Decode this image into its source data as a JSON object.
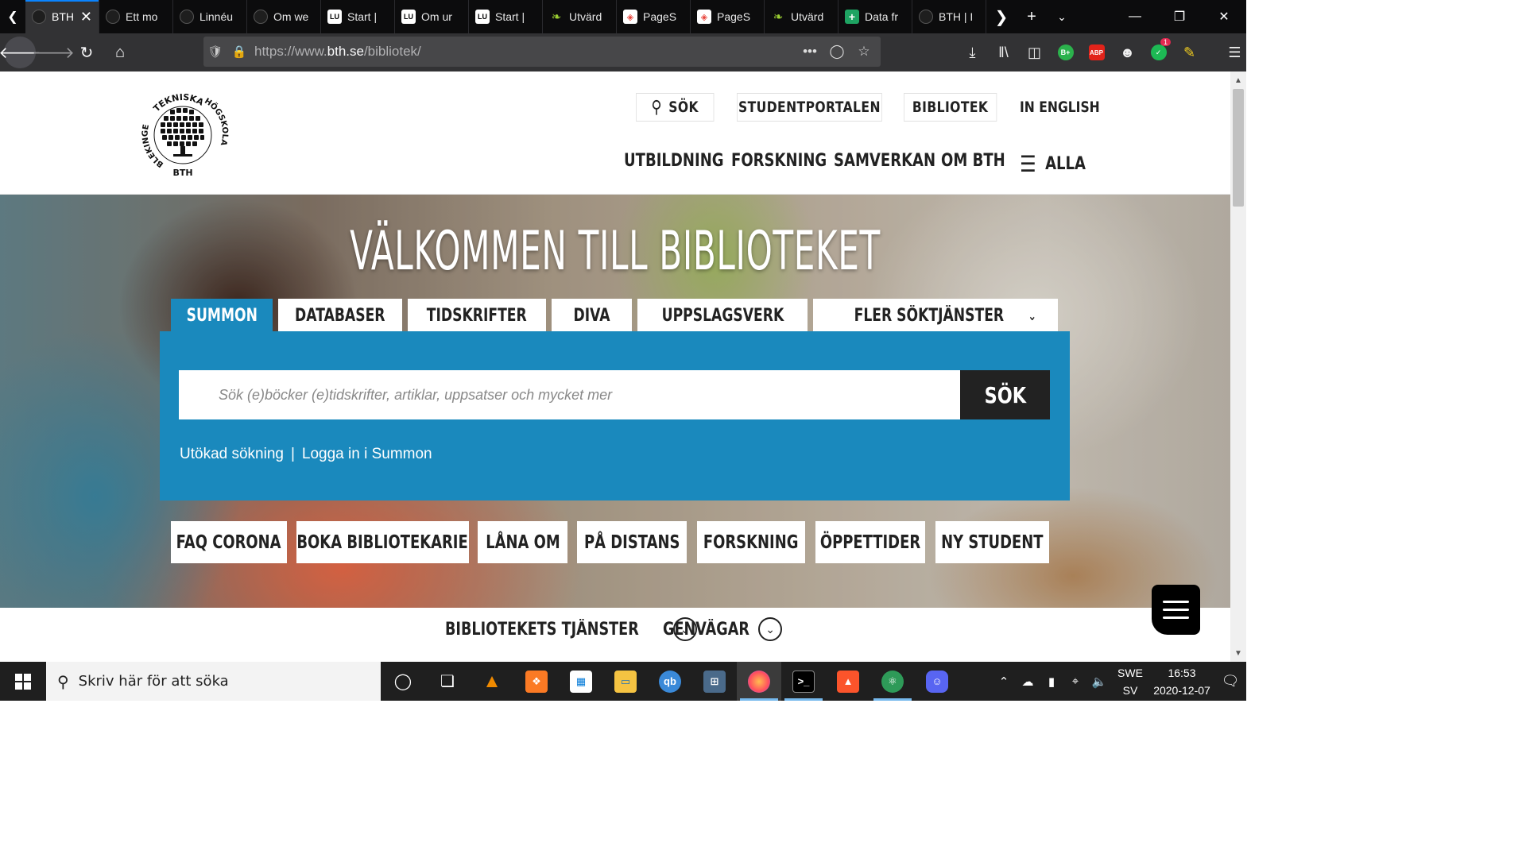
{
  "browser": {
    "tabs": [
      {
        "title": "BTH",
        "favicon": "dark-circle",
        "active": true
      },
      {
        "title": "Ett mo",
        "favicon": "dark-circle"
      },
      {
        "title": "Linnéu",
        "favicon": "dark-circle"
      },
      {
        "title": "Om we",
        "favicon": "dark-circle"
      },
      {
        "title": "Start |",
        "favicon": "LU"
      },
      {
        "title": "Om ur",
        "favicon": "LU"
      },
      {
        "title": "Start |",
        "favicon": "LU"
      },
      {
        "title": "Utvärd",
        "favicon": "leaf"
      },
      {
        "title": "PageS",
        "favicon": "pagespeed"
      },
      {
        "title": "PageS",
        "favicon": "pagespeed"
      },
      {
        "title": "Utvärd",
        "favicon": "leaf"
      },
      {
        "title": "Data fr",
        "favicon": "plus-green"
      },
      {
        "title": "BTH | I",
        "favicon": "dark-circle"
      }
    ],
    "url_prefix": "https://www.",
    "url_domain": "bth.se",
    "url_path": "/bibliotek/",
    "extension_badge": "1",
    "accent": "#0a84ff"
  },
  "site": {
    "logo_text_top": "TEKNISKA",
    "logo_text_right": "HÖGSKOLA",
    "logo_text_left": "BLEKINGE",
    "logo_text_bottom": "BTH",
    "utility": {
      "search": "SÖK",
      "student_portal": "STUDENTPORTALEN",
      "library": "BIBLIOTEK",
      "english": "IN ENGLISH"
    },
    "main_nav": {
      "education": "UTBILDNING",
      "research": "FORSKNING",
      "collaboration": "SAMVERKAN",
      "about": "OM BTH",
      "all": "ALLA"
    }
  },
  "hero": {
    "title": "VÄLKOMMEN TILL BIBLIOTEKET",
    "tabs": {
      "summon": "SUMMON",
      "databases": "DATABASER",
      "journals": "TIDSKRIFTER",
      "diva": "DIVA",
      "reference": "UPPSLAGSVERK",
      "more": "FLER SÖKTJÄNSTER"
    },
    "search_placeholder": "Sök (e)böcker (e)tidskrifter, artiklar, uppsatser och mycket mer",
    "search_button": "SÖK",
    "advanced_search": "Utökad sökning",
    "separator": "|",
    "login_summon": "Logga in i Summon",
    "panel_color": "#1a89bd",
    "quick_links": {
      "faq_corona": "FAQ CORONA",
      "book_librarian": "BOKA BIBLIOTEKARIE",
      "renew": "LÅNA OM",
      "distance": "PÅ DISTANS",
      "research": "FORSKNING",
      "opening_hours": "ÖPPETTIDER",
      "new_student": "NY STUDENT"
    }
  },
  "bottom": {
    "services": "BIBLIOTEKETS TJÄNSTER",
    "shortcuts": "GENVÄGAR"
  },
  "taskbar": {
    "search_placeholder": "Skriv här för att söka",
    "language_top": "SWE",
    "language_bottom": "SV",
    "time": "16:53",
    "date": "2020-12-07"
  }
}
